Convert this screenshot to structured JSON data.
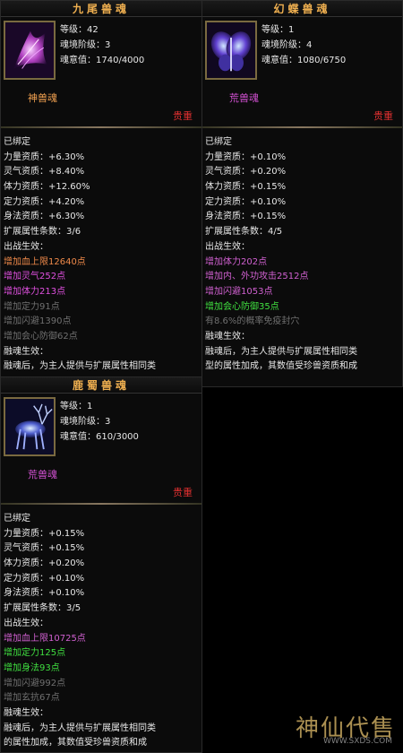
{
  "panels": [
    {
      "title": "九尾兽魂",
      "stats": {
        "level": "等级：42",
        "realm": "魂境阶级：3",
        "soul": "魂意值：1740/4000"
      },
      "type_label": "神兽魂",
      "type_color": "#f0a050",
      "rarity": "贵重",
      "icon": "purple-nine-tail-fox-icon",
      "lines": [
        {
          "t": "已绑定",
          "c": "white"
        },
        {
          "t": "力量资质：+6.30%",
          "c": "white"
        },
        {
          "t": "灵气资质：+8.40%",
          "c": "white"
        },
        {
          "t": "体力资质：+12.60%",
          "c": "white"
        },
        {
          "t": "定力资质：+4.20%",
          "c": "white"
        },
        {
          "t": "身法资质：+6.30%",
          "c": "white"
        },
        {
          "t": "扩展属性条数：3/6",
          "c": "white"
        },
        {
          "t": "出战生效：",
          "c": "white"
        },
        {
          "t": "增加血上限12640点",
          "c": "orange"
        },
        {
          "t": "增加灵气252点",
          "c": "purple"
        },
        {
          "t": "增加体力213点",
          "c": "purple"
        },
        {
          "t": "增加定力91点",
          "c": "gray"
        },
        {
          "t": "增加闪避1390点",
          "c": "gray"
        },
        {
          "t": "增加会心防御62点",
          "c": "gray"
        },
        {
          "t": "融魂生效：",
          "c": "white"
        },
        {
          "t": "融魂后，为主人提供与扩展属性相同类",
          "c": "white"
        }
      ]
    },
    {
      "title": "幻蝶兽魂",
      "stats": {
        "level": "等级：1",
        "realm": "魂境阶级：4",
        "soul": "魂意值：1080/6750"
      },
      "type_label": "荒兽魂",
      "type_color": "#d050d0",
      "rarity": "贵重",
      "icon": "blue-butterfly-icon",
      "lines": [
        {
          "t": "已绑定",
          "c": "white"
        },
        {
          "t": "力量资质：+0.10%",
          "c": "white"
        },
        {
          "t": "灵气资质：+0.20%",
          "c": "white"
        },
        {
          "t": "体力资质：+0.15%",
          "c": "white"
        },
        {
          "t": "定力资质：+0.10%",
          "c": "white"
        },
        {
          "t": "身法资质：+0.15%",
          "c": "white"
        },
        {
          "t": "扩展属性条数：4/5",
          "c": "white"
        },
        {
          "t": "出战生效：",
          "c": "white"
        },
        {
          "t": "增加体力202点",
          "c": "pink"
        },
        {
          "t": "增加内、外功攻击2512点",
          "c": "pink"
        },
        {
          "t": "增加闪避1053点",
          "c": "pink"
        },
        {
          "t": "增加会心防御35点",
          "c": "green"
        },
        {
          "t": "有8.6%的概率免疫封穴",
          "c": "gray"
        },
        {
          "t": "融魂生效：",
          "c": "white"
        },
        {
          "t": "融魂后，为主人提供与扩展属性相同类",
          "c": "white"
        },
        {
          "t": "型的属性加成，其数值受珍兽资质和成",
          "c": "white"
        }
      ]
    },
    {
      "title": "鹿蜀兽魂",
      "stats": {
        "level": "等级：1",
        "realm": "魂境阶级：3",
        "soul": "魂意值：610/3000"
      },
      "type_label": "荒兽魂",
      "type_color": "#d050d0",
      "rarity": "贵重",
      "icon": "blue-deer-icon",
      "lines": [
        {
          "t": "已绑定",
          "c": "white"
        },
        {
          "t": "力量资质：+0.15%",
          "c": "white"
        },
        {
          "t": "灵气资质：+0.15%",
          "c": "white"
        },
        {
          "t": "体力资质：+0.20%",
          "c": "white"
        },
        {
          "t": "定力资质：+0.10%",
          "c": "white"
        },
        {
          "t": "身法资质：+0.10%",
          "c": "white"
        },
        {
          "t": "扩展属性条数：3/5",
          "c": "white"
        },
        {
          "t": "出战生效：",
          "c": "white"
        },
        {
          "t": "增加血上限10725点",
          "c": "pink"
        },
        {
          "t": "增加定力125点",
          "c": "green"
        },
        {
          "t": "增加身法93点",
          "c": "green"
        },
        {
          "t": "增加闪避992点",
          "c": "gray"
        },
        {
          "t": "增加玄抗67点",
          "c": "gray"
        },
        {
          "t": "融魂生效：",
          "c": "white"
        },
        {
          "t": "融魂后，为主人提供与扩展属性相同类",
          "c": "white"
        },
        {
          "t": "的属性加成，其数值受珍兽资质和成",
          "c": "white"
        }
      ]
    }
  ],
  "watermark": {
    "text": "神仙代售",
    "url": "WWW.SXDS.COM"
  }
}
